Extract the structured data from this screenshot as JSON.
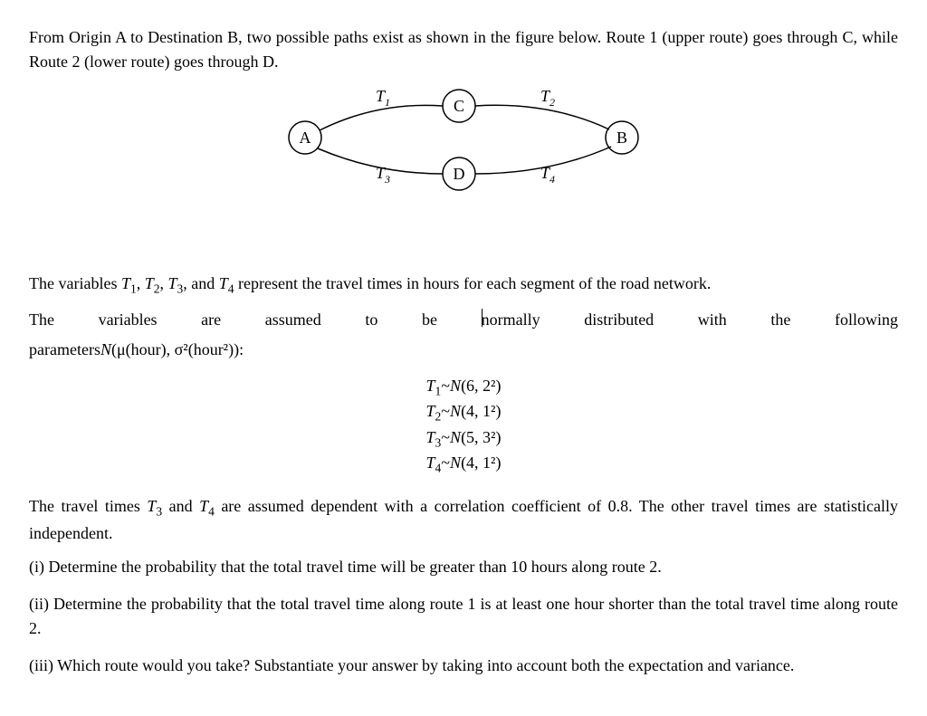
{
  "intro": {
    "p1": "From Origin A to Destination B, two possible paths exist as shown in the figure below. Route 1 (upper route) goes through C, while Route 2 (lower route) goes through D."
  },
  "figure": {
    "nodes": {
      "A": "A",
      "B": "B",
      "C": "C",
      "D": "D"
    },
    "edgeLabels": {
      "T1": "T",
      "T2": "T",
      "T3": "T",
      "T4": "T"
    },
    "edgeSubs": {
      "T1": "1",
      "T2": "2",
      "T3": "3",
      "T4": "4"
    }
  },
  "body": {
    "p2a_pre": "The variables ",
    "p2a_post": " represent the travel times in hours for each segment of the road network.",
    "p2b_pre": "The variables are assumed to be ",
    "p2b_mid": "normally distributed with the following",
    "p2c": "parameters",
    "p2c_fn": "N",
    "p2c_args": "(μ(hour), σ²(hour²)):"
  },
  "vars": {
    "T1": "T",
    "s1": "1",
    "T2": "T",
    "s2": "2",
    "T3": "T",
    "s3": "3",
    "T4": "T",
    "s4": "4",
    "sep12": ", ",
    "sep23": ", ",
    "sep34": ", and "
  },
  "eqs": {
    "l1": {
      "lhs": "T",
      "lsub": "1",
      "tilde": "~",
      "N": "N",
      "args": "(6, 2²)"
    },
    "l2": {
      "lhs": "T",
      "lsub": "2",
      "tilde": "~",
      "N": "N",
      "args": "(4, 1²)"
    },
    "l3": {
      "lhs": "T",
      "lsub": "3",
      "tilde": "~",
      "N": "N",
      "args": "(5, 3²)"
    },
    "l4": {
      "lhs": "T",
      "lsub": "4",
      "tilde": "~",
      "N": "N",
      "args": "(4, 1²)"
    }
  },
  "body2": {
    "p3_pre": "The travel times ",
    "p3_mid": " and ",
    "p3_post": " are assumed dependent with a correlation coefficient of 0.8. The other travel times are statistically independent."
  },
  "questions": {
    "q1": "(i) Determine the probability that the total travel time will be greater than 10 hours along route 2.",
    "q2": "(ii) Determine the probability that the total travel time along route 1 is at least one hour shorter than the total travel time along route 2.",
    "q3": "(iii) Which route would you take? Substantiate your answer by taking into account both the expectation and variance."
  },
  "chart_data": {
    "type": "diagram",
    "title": "Two-route network from A to B",
    "nodes": [
      "A",
      "C",
      "D",
      "B"
    ],
    "edges": [
      {
        "from": "A",
        "to": "C",
        "label": "T1",
        "route": 1
      },
      {
        "from": "C",
        "to": "B",
        "label": "T2",
        "route": 1
      },
      {
        "from": "A",
        "to": "D",
        "label": "T3",
        "route": 2
      },
      {
        "from": "D",
        "to": "B",
        "label": "T4",
        "route": 2
      }
    ],
    "variables": {
      "T1": {
        "distribution": "Normal",
        "mean": 6,
        "variance": 4
      },
      "T2": {
        "distribution": "Normal",
        "mean": 4,
        "variance": 1
      },
      "T3": {
        "distribution": "Normal",
        "mean": 5,
        "variance": 9
      },
      "T4": {
        "distribution": "Normal",
        "mean": 4,
        "variance": 1
      }
    },
    "correlation": {
      "pair": [
        "T3",
        "T4"
      ],
      "rho": 0.8
    },
    "independence": "All other travel times are statistically independent.",
    "routes": {
      "1": [
        "T1",
        "T2"
      ],
      "2": [
        "T3",
        "T4"
      ]
    }
  }
}
